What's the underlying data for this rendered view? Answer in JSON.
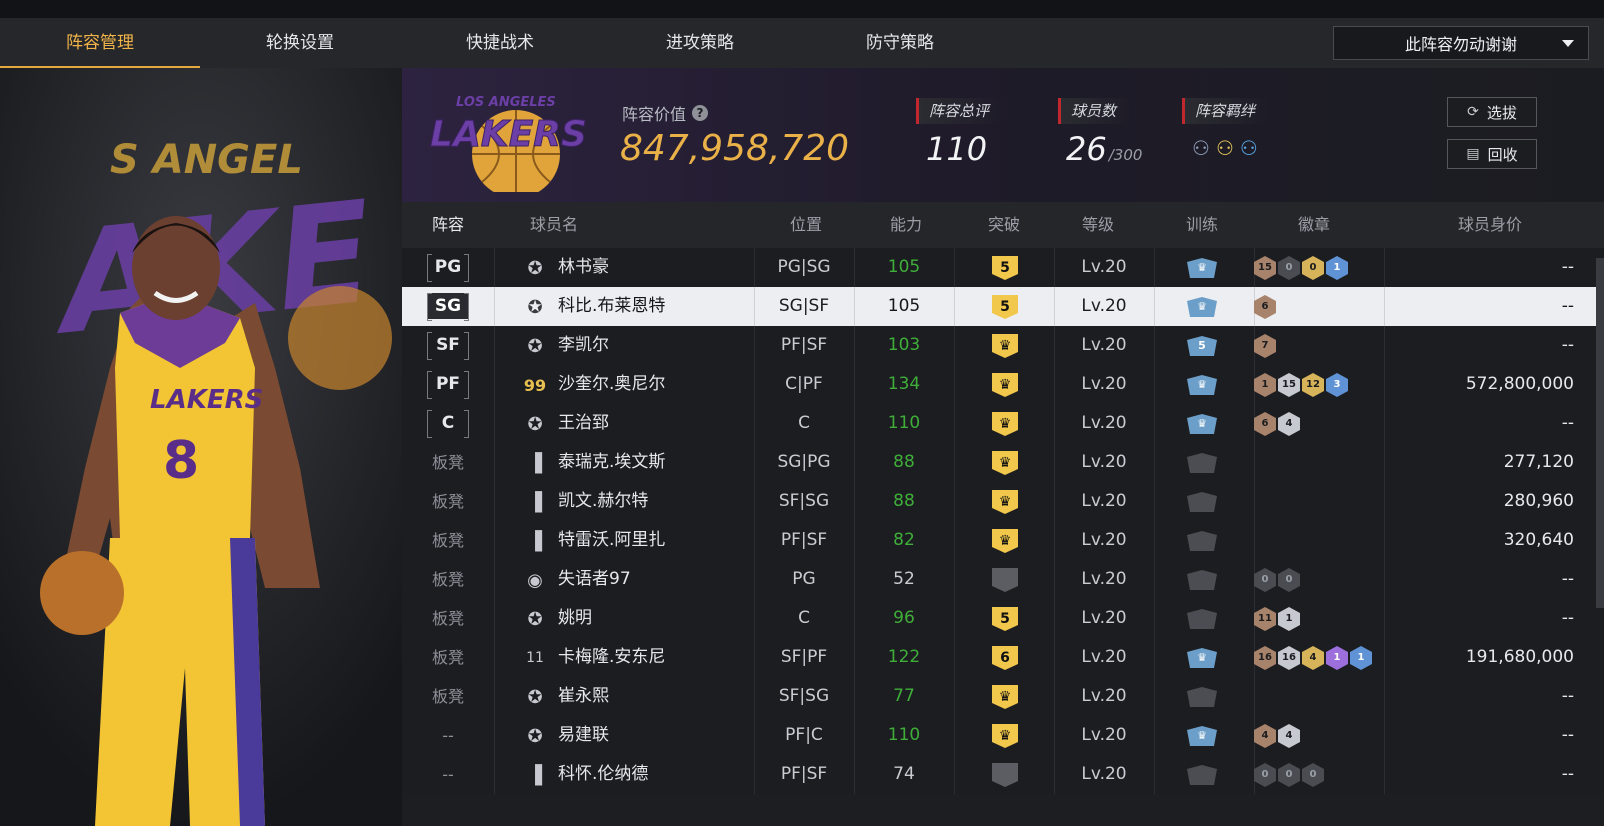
{
  "nav": {
    "tabs": [
      "阵容管理",
      "轮换设置",
      "快捷战术",
      "进攻策略",
      "防守策略"
    ],
    "active_tab": "阵容管理",
    "dropdown_value": "此阵容勿动谢谢"
  },
  "team": {
    "value_label": "阵容价值",
    "value": "847,958,720",
    "rating_label": "阵容总评",
    "rating": "110",
    "players_label": "球员数",
    "players_count": "26",
    "players_max": "/300",
    "bond_label": "阵容羁绊",
    "select_button": "选拔",
    "recycle_button": "回收",
    "logo_text": "LAKERS",
    "logo_sub": "LOS ANGELES"
  },
  "table": {
    "headers": [
      "阵容",
      "球员名",
      "位置",
      "能力",
      "突破",
      "等级",
      "训练",
      "徽章",
      "球员身价"
    ],
    "rows": [
      {
        "slot": "PG",
        "name": "林书豪",
        "icon": "star-icon",
        "position": "PG|SG",
        "ability": "105",
        "green": true,
        "breakthrough": "5",
        "level": "Lv.20",
        "train": "crown",
        "badges": [
          [
            "bronze",
            "15"
          ],
          [
            "dark",
            "0"
          ],
          [
            "gold",
            "0"
          ],
          [
            "blue",
            "1"
          ]
        ],
        "worth": "--"
      },
      {
        "slot": "SG",
        "name": "科比.布莱恩特",
        "icon": "star-icon",
        "position": "SG|SF",
        "ability": "105",
        "green": true,
        "breakthrough": "5",
        "level": "Lv.20",
        "train": "crown",
        "badges": [
          [
            "bronze",
            "6"
          ]
        ],
        "worth": "--",
        "selected": true
      },
      {
        "slot": "SF",
        "name": "李凯尔",
        "icon": "star-icon",
        "position": "PF|SF",
        "ability": "103",
        "green": true,
        "breakthrough": "crown",
        "level": "Lv.20",
        "train": "5",
        "badges": [
          [
            "bronze",
            "7"
          ]
        ],
        "worth": "--"
      },
      {
        "slot": "PF",
        "name": "沙奎尔.奥尼尔",
        "icon": "99-icon",
        "position": "C|PF",
        "ability": "134",
        "green": true,
        "breakthrough": "crown",
        "level": "Lv.20",
        "train": "crown",
        "badges": [
          [
            "bronze",
            "1"
          ],
          [
            "silver",
            "15"
          ],
          [
            "gold",
            "12"
          ],
          [
            "blue",
            "3"
          ]
        ],
        "worth": "572,800,000"
      },
      {
        "slot": "C",
        "name": "王治郅",
        "icon": "star-icon",
        "position": "C",
        "ability": "110",
        "green": true,
        "breakthrough": "crown",
        "level": "Lv.20",
        "train": "crown",
        "badges": [
          [
            "bronze",
            "6"
          ],
          [
            "silver",
            "4"
          ]
        ],
        "worth": "--"
      },
      {
        "slot": "板凳",
        "name": "泰瑞克.埃文斯",
        "icon": "bars-icon",
        "position": "SG|PG",
        "ability": "88",
        "green": true,
        "breakthrough": "crown",
        "level": "Lv.20",
        "train": "gray",
        "badges": [],
        "worth": "277,120"
      },
      {
        "slot": "板凳",
        "name": "凯文.赫尔特",
        "icon": "bars-icon",
        "position": "SF|SG",
        "ability": "88",
        "green": true,
        "breakthrough": "crown",
        "level": "Lv.20",
        "train": "gray",
        "badges": [],
        "worth": "280,960"
      },
      {
        "slot": "板凳",
        "name": "特雷沃.阿里扎",
        "icon": "bars-icon",
        "position": "PF|SF",
        "ability": "82",
        "green": true,
        "breakthrough": "crown",
        "level": "Lv.20",
        "train": "gray",
        "badges": [],
        "worth": "320,640"
      },
      {
        "slot": "板凳",
        "name": "失语者97",
        "icon": "user-icon",
        "position": "PG",
        "ability": "52",
        "green": false,
        "breakthrough": "gray",
        "level": "Lv.20",
        "train": "gray",
        "badges": [
          [
            "dark",
            "0"
          ],
          [
            "dark",
            "0"
          ]
        ],
        "worth": "--"
      },
      {
        "slot": "板凳",
        "name": "姚明",
        "icon": "star-icon",
        "position": "C",
        "ability": "96",
        "green": true,
        "breakthrough": "5",
        "level": "Lv.20",
        "train": "gray",
        "badges": [
          [
            "bronze",
            "11"
          ],
          [
            "silver",
            "1"
          ]
        ],
        "worth": "--"
      },
      {
        "slot": "板凳",
        "name": "卡梅隆.安东尼",
        "icon": "11-icon",
        "position": "SF|PF",
        "ability": "122",
        "green": true,
        "breakthrough": "6",
        "level": "Lv.20",
        "train": "crown",
        "badges": [
          [
            "bronze",
            "16"
          ],
          [
            "silver",
            "16"
          ],
          [
            "gold",
            "4"
          ],
          [
            "purple",
            "1"
          ],
          [
            "blue",
            "1"
          ]
        ],
        "worth": "191,680,000"
      },
      {
        "slot": "板凳",
        "name": "崔永熙",
        "icon": "star-icon",
        "position": "SF|SG",
        "ability": "77",
        "green": true,
        "breakthrough": "crown",
        "level": "Lv.20",
        "train": "gray",
        "badges": [],
        "worth": "--"
      },
      {
        "slot": "--",
        "name": "易建联",
        "icon": "star-icon",
        "position": "PF|C",
        "ability": "110",
        "green": true,
        "breakthrough": "crown",
        "level": "Lv.20",
        "train": "crown",
        "badges": [
          [
            "bronze",
            "4"
          ],
          [
            "silver",
            "4"
          ]
        ],
        "worth": "--"
      },
      {
        "slot": "--",
        "name": "科怀.伦纳德",
        "icon": "bars-icon",
        "position": "PF|SF",
        "ability": "74",
        "green": false,
        "breakthrough": "gray",
        "level": "Lv.20",
        "train": "gray",
        "badges": [
          [
            "dark",
            "0"
          ],
          [
            "dark",
            "0"
          ],
          [
            "dark",
            "0"
          ]
        ],
        "worth": "--"
      }
    ]
  },
  "hero": {
    "jersey_text": "LAKERS",
    "jersey_number": "8"
  },
  "colors": {
    "accent": "#f1b44a",
    "green": "#3fae39",
    "bg": "#1a1b1f"
  }
}
